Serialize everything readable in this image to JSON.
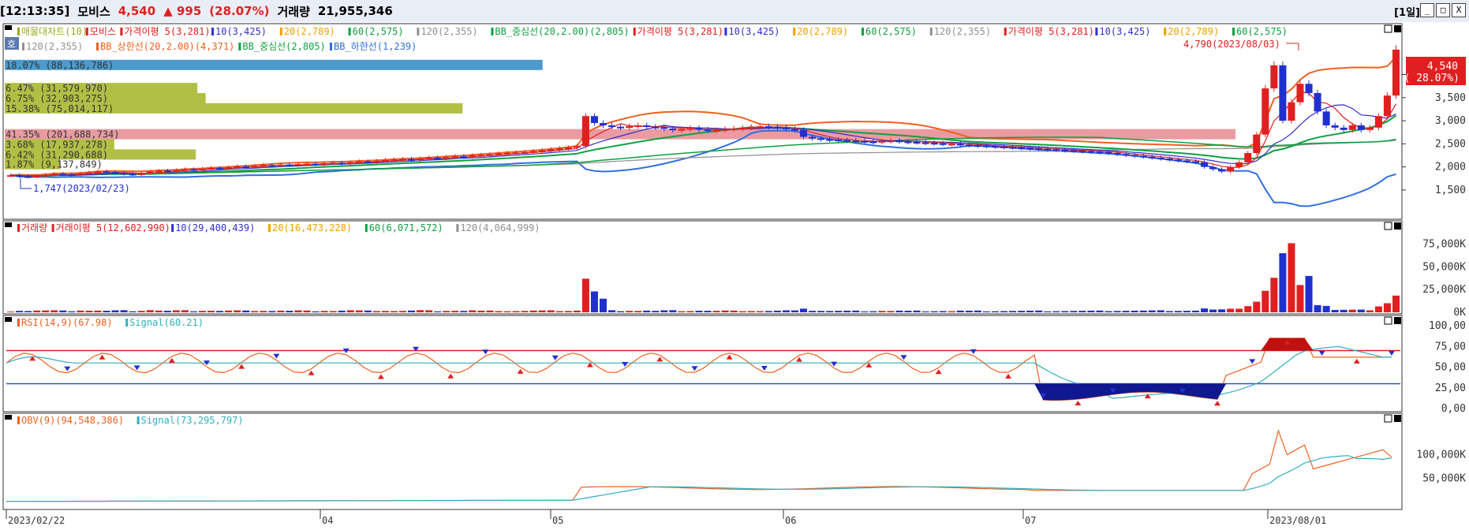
{
  "header": {
    "time": "[12:13:35]",
    "name": "모비스",
    "price": "4,540",
    "change": "▲ 995",
    "pct": "(28.07%)",
    "volume_label": "거래량",
    "volume": "21,955,346",
    "period": "[1일]",
    "buttons": [
      "_",
      "□",
      "X"
    ]
  },
  "colors": {
    "up": "#e02020",
    "down": "#2030d0",
    "bg": "#ffffff"
  },
  "price_legend_row1": [
    {
      "text": "매물대차트(10)",
      "color": "#9aaa20"
    },
    {
      "text": "모비스",
      "color": "#e02020"
    },
    {
      "text": "가격이평 5(3,281)",
      "color": "#e02020"
    },
    {
      "text": "10(3,425)",
      "color": "#3030d0"
    },
    {
      "text": "20(2,789)",
      "color": "#f0a000"
    },
    {
      "text": "60(2,575)",
      "color": "#10a040"
    },
    {
      "text": "120(2,355)",
      "color": "#909090"
    },
    {
      "text": "BB_중심선(20,2.00)(2,805)",
      "color": "#10a040"
    },
    {
      "text": "가격이평 5(3,281)",
      "color": "#e02020"
    },
    {
      "text": "10(3,425)",
      "color": "#3030d0"
    },
    {
      "text": "20(2,789)",
      "color": "#f0a000"
    },
    {
      "text": "60(2,575)",
      "color": "#10a040"
    },
    {
      "text": "120(2,355)",
      "color": "#909090"
    },
    {
      "text": "가격이평 5(3,281)",
      "color": "#e02020"
    },
    {
      "text": "10(3,425)",
      "color": "#3030d0"
    },
    {
      "text": "20(2,789)",
      "color": "#f0a000"
    },
    {
      "text": "60(2,575)",
      "color": "#10a040"
    }
  ],
  "price_legend_row2": [
    {
      "text": "120(2,355)",
      "color": "#909090"
    },
    {
      "text": "BB_상한선(20,2.00)(4,371)",
      "color": "#f06020"
    },
    {
      "text": "BB_중심선(2,805)",
      "color": "#10a040"
    },
    {
      "text": "BB_하한선(1,239)",
      "color": "#3070e0"
    }
  ],
  "ho_label": "호",
  "volume_profile": [
    {
      "label": "18.07% (88,136,786)",
      "pct": 18.07,
      "color": "#3a90c8",
      "price": 4200
    },
    {
      "label": "6.47% (31,579,970)",
      "pct": 6.47,
      "color": "#a8b830",
      "price": 3700
    },
    {
      "label": "6.75% (32,903,275)",
      "pct": 6.75,
      "color": "#a8b830",
      "price": 3480
    },
    {
      "label": "15.38% (75,014,117)",
      "pct": 15.38,
      "color": "#a8b830",
      "price": 3260
    },
    {
      "label": "41.35% (201,688,734)",
      "pct": 41.35,
      "color": "#e89098",
      "price": 2700
    },
    {
      "label": "3.68% (17,937,278)",
      "pct": 3.68,
      "color": "#a8b830",
      "price": 2480
    },
    {
      "label": "6.42% (31,290,688)",
      "pct": 6.42,
      "color": "#a8b830",
      "price": 2260
    },
    {
      "label": "1.87% (9,137,849)",
      "pct": 1.87,
      "color": "#a8b830",
      "price": 2050
    }
  ],
  "price_axis": {
    "ticks": [
      "4,000",
      "3,500",
      "3,000",
      "2,500",
      "2,000",
      "1,500"
    ],
    "values": [
      4000,
      3500,
      3000,
      2500,
      2000,
      1500
    ],
    "min": 900,
    "max": 5000
  },
  "current_price_tag": {
    "price": "4,540",
    "pct": "( 28.07%)"
  },
  "annotations": {
    "high": "4,790(2023/08/03)",
    "low": "1,747(2023/02/23)"
  },
  "volume_panel": {
    "legend": [
      {
        "text": "거래량",
        "color": "#e02020"
      },
      {
        "text": "거래이평 5(12,602,990)",
        "color": "#e02020"
      },
      {
        "text": "10(29,400,439)",
        "color": "#3030d0"
      },
      {
        "text": "20(16,473,228)",
        "color": "#f0a000"
      },
      {
        "text": "60(6,071,572)",
        "color": "#10a040"
      },
      {
        "text": "120(4,064,999)",
        "color": "#909090"
      }
    ],
    "ticks": [
      "75,000K",
      "50,000K",
      "25,000K",
      "0K"
    ],
    "values": [
      75000,
      50000,
      25000,
      0
    ],
    "max": 85000
  },
  "rsi_panel": {
    "legend": [
      {
        "text": "RSI(14,9)(67.98)",
        "color": "#f06020"
      },
      {
        "text": "Signal(60.21)",
        "color": "#30b0c0"
      }
    ],
    "ticks": [
      "100,00",
      "75,00",
      "50,00",
      "25,00",
      "0,00"
    ],
    "values": [
      100,
      75,
      50,
      25,
      0
    ],
    "upper": 70,
    "lower": 30
  },
  "obv_panel": {
    "legend": [
      {
        "text": "OBV(9)(94,548,386)",
        "color": "#f06020"
      },
      {
        "text": "Signal(73,295,797)",
        "color": "#30b0c0"
      }
    ],
    "ticks": [
      "100,000K",
      "50,000K"
    ],
    "values": [
      100000,
      50000
    ],
    "min": -10000,
    "max": 160000
  },
  "date_axis": [
    "2023/02/22",
    "04",
    "05",
    "06",
    "07",
    "2023/08/01"
  ],
  "chart_data": {
    "type": "candlestick",
    "x_start": "2023/02/22",
    "close": [
      1820,
      1800,
      1790,
      1810,
      1830,
      1850,
      1840,
      1830,
      1860,
      1880,
      1900,
      1890,
      1870,
      1850,
      1840,
      1860,
      1900,
      1920,
      1910,
      1930,
      1950,
      1940,
      1960,
      1980,
      1970,
      1990,
      2010,
      2000,
      2020,
      2040,
      2030,
      2050,
      2040,
      2060,
      2070,
      2060,
      2080,
      2090,
      2070,
      2100,
      2120,
      2110,
      2130,
      2150,
      2160,
      2170,
      2150,
      2180,
      2200,
      2190,
      2210,
      2230,
      2220,
      2250,
      2260,
      2270,
      2290,
      2300,
      2310,
      2320,
      2340,
      2360,
      2380,
      2400,
      2420,
      2450,
      3100,
      2950,
      2900,
      2870,
      2850,
      2880,
      2900,
      2870,
      2860,
      2830,
      2800,
      2820,
      2840,
      2810,
      2790,
      2800,
      2820,
      2830,
      2850,
      2870,
      2880,
      2870,
      2850,
      2820,
      2800,
      2650,
      2620,
      2600,
      2590,
      2580,
      2570,
      2560,
      2550,
      2540,
      2560,
      2570,
      2550,
      2540,
      2530,
      2520,
      2510,
      2500,
      2500,
      2480,
      2470,
      2460,
      2450,
      2440,
      2430,
      2420,
      2410,
      2400,
      2390,
      2380,
      2370,
      2360,
      2350,
      2340,
      2330,
      2320,
      2300,
      2280,
      2260,
      2240,
      2220,
      2200,
      2180,
      2160,
      2140,
      2120,
      2100,
      2000,
      1950,
      1900,
      2000,
      2100,
      2300,
      2700,
      3700,
      4200,
      3000,
      3400,
      3800,
      3600,
      3200,
      2900,
      2850,
      2800,
      2900,
      2800,
      2850,
      3100,
      3545,
      4540
    ],
    "price_min": 900,
    "price_max": 5000,
    "bollinger": {
      "upper": 4371,
      "middle": 2805,
      "lower": 1239
    }
  }
}
